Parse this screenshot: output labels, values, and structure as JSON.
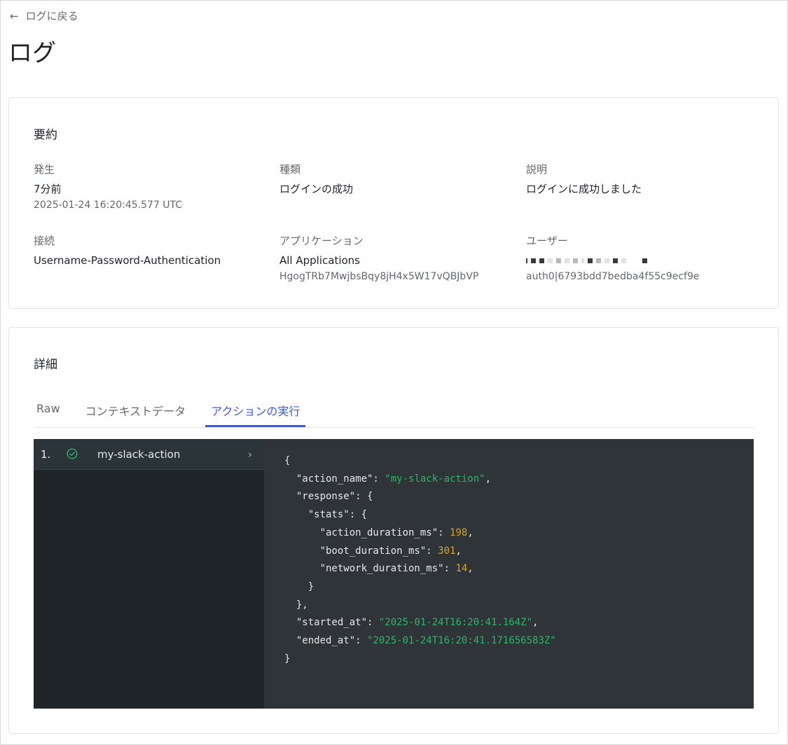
{
  "nav": {
    "back_label": "ログに戻る",
    "back_icon": "arrow-left-icon"
  },
  "page": {
    "title": "ログ"
  },
  "summary": {
    "title": "要約",
    "fields": {
      "occurred": {
        "label": "発生",
        "value": "7分前",
        "sub": "2025-01-24 16:20:45.577 UTC"
      },
      "type": {
        "label": "種類",
        "value": "ログインの成功"
      },
      "description": {
        "label": "説明",
        "value": "ログインに成功しました"
      },
      "connection": {
        "label": "接続",
        "value": "Username-Password-Authentication"
      },
      "application": {
        "label": "アプリケーション",
        "value": "All Applications",
        "sub": "HgogTRb7MwjbsBqy8jH4x5W17vQBJbVP"
      },
      "user": {
        "label": "ユーザー",
        "sub": "auth0|6793bdd7bedba4f55c9ecf9e"
      }
    }
  },
  "details": {
    "title": "詳細",
    "tabs": [
      {
        "label": "Raw",
        "active": false
      },
      {
        "label": "コンテキストデータ",
        "active": false
      },
      {
        "label": "アクションの実行",
        "active": true
      }
    ],
    "executions": [
      {
        "index": "1.",
        "name": "my-slack-action",
        "status": "success-check-icon"
      }
    ],
    "json": {
      "action_name": "my-slack-action",
      "action_duration_ms": "198",
      "boot_duration_ms": "301",
      "network_duration_ms": "14",
      "started_at": "2025-01-24T16:20:41.164Z",
      "ended_at": "2025-01-24T16:20:41.171656583Z"
    }
  },
  "colors": {
    "accent": "#3f59e4",
    "code_bg": "#2f3439",
    "code_sidebar": "#1f2529",
    "string": "#2fb36b",
    "number": "#d6a728",
    "success": "#2fb36b"
  }
}
